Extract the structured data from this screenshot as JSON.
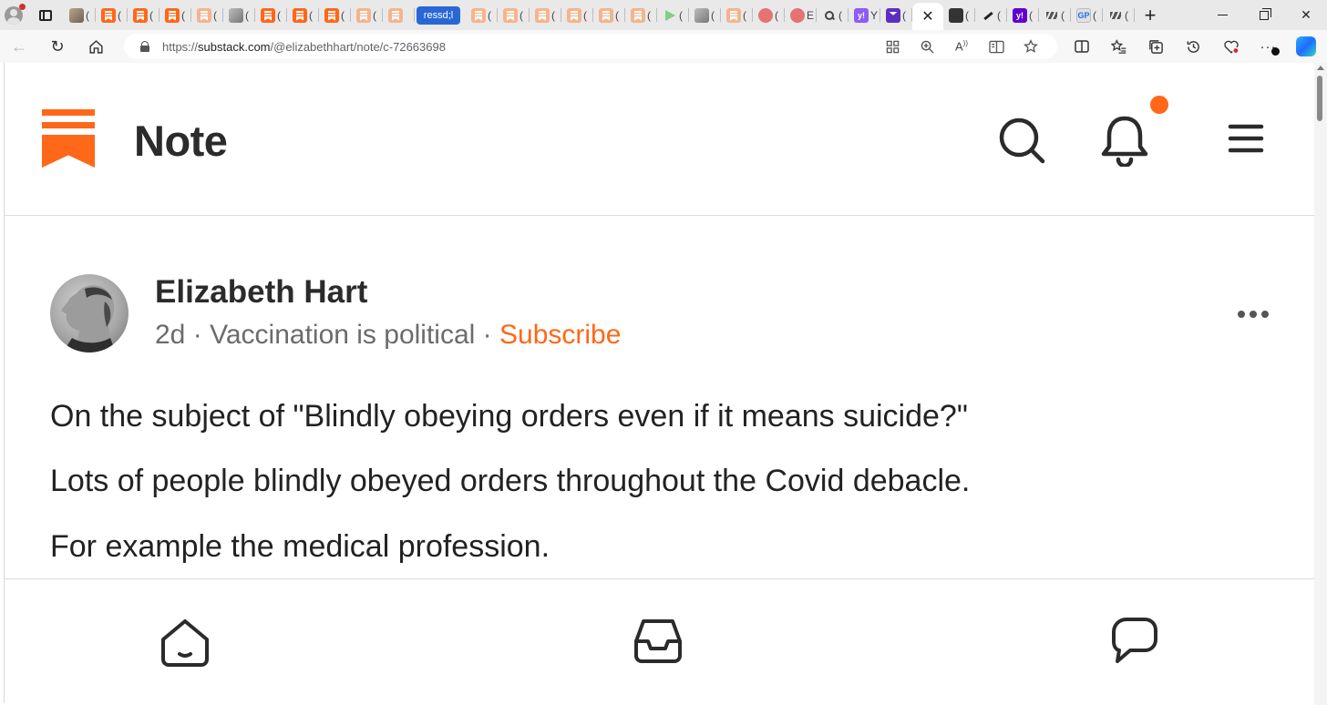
{
  "browser": {
    "highlight_tab_label": "ressd;l",
    "tab_chars": [
      "(",
      "(",
      "(",
      "(",
      "(",
      "(",
      "(",
      "(",
      "(",
      "(",
      "(",
      "(",
      "(",
      "(",
      "(",
      "(",
      "(",
      "(",
      "(",
      "(",
      "(",
      "E",
      "(",
      "Y",
      "(",
      "(",
      "(",
      "(",
      "(",
      "(",
      "(",
      "("
    ],
    "url_prefix": "https://",
    "url_host": "substack.com",
    "url_path": "/@elizabethhart/note/c-72663698"
  },
  "header": {
    "title": "Note",
    "accent_color": "#ff6719"
  },
  "post": {
    "author": "Elizabeth Hart",
    "age": "2d",
    "separator": "·",
    "publication": "Vaccination is political",
    "subscribe_label": "Subscribe",
    "paragraphs": [
      "On the subject of \"Blindly obeying orders even if it means suicide?\"",
      "Lots of people blindly obeyed orders throughout the Covid debacle.",
      "For example the medical profession."
    ]
  },
  "icons": {
    "header": [
      "search-icon",
      "bell-icon",
      "menu-icon"
    ],
    "bottom_nav": [
      "home-icon",
      "inbox-icon",
      "chat-icon"
    ]
  }
}
